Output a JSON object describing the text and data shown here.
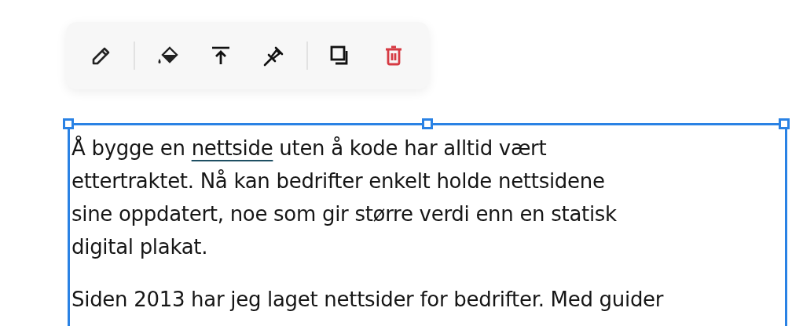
{
  "toolbar": {
    "items": [
      {
        "kind": "button"
      },
      {
        "kind": "separator"
      },
      {
        "kind": "button"
      },
      {
        "kind": "button"
      },
      {
        "kind": "button"
      },
      {
        "kind": "separator"
      },
      {
        "kind": "button"
      },
      {
        "kind": "button",
        "danger": true
      }
    ]
  },
  "text_block": {
    "selected": true,
    "paragraphs": [
      {
        "segments": [
          {
            "text": "Å bygge en "
          },
          {
            "text": "nettside",
            "underlined": true
          },
          {
            "text": " uten å kode har alltid vært ettertraktet. Nå kan bedrifter enkelt holde nettsidene sine oppdatert, noe som gir større verdi enn en statisk digital plakat."
          }
        ]
      },
      {
        "segments": [
          {
            "text": "Siden 2013 har jeg laget nettsider for bedrifter. Med guider"
          }
        ]
      }
    ]
  }
}
